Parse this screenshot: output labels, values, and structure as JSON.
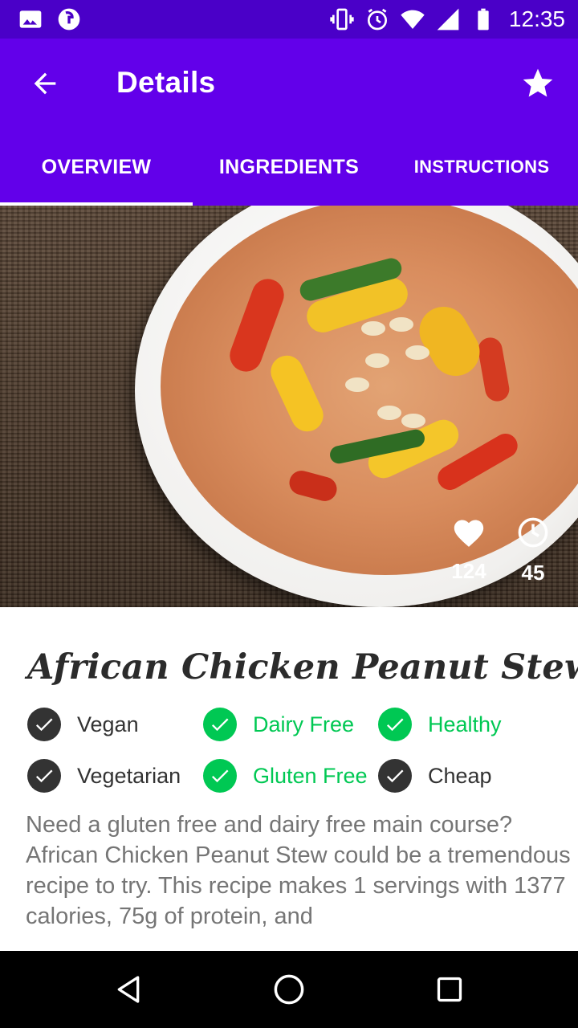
{
  "status_bar": {
    "time": "12:35",
    "left_icons": [
      "image-icon",
      "sync-icon"
    ],
    "right_icons": [
      "vibrate-icon",
      "alarm-icon",
      "wifi-icon",
      "signal-icon",
      "battery-icon"
    ]
  },
  "app_bar": {
    "title": "Details",
    "back_icon": "arrow-back-icon",
    "favorite_icon": "star-icon"
  },
  "tabs": [
    {
      "label": "OVERVIEW",
      "selected": true
    },
    {
      "label": "INGREDIENTS",
      "selected": false
    },
    {
      "label": "INSTRUCTIONS",
      "selected": false
    }
  ],
  "hero": {
    "likes": "124",
    "minutes": "45",
    "likes_icon": "heart-icon",
    "time_icon": "clock-icon"
  },
  "recipe": {
    "title": "African Chicken Peanut Stew",
    "summary": "Need a gluten free and dairy free main course? African Chicken Peanut Stew could be a tremendous recipe to try. This recipe makes 1 servings with 1377 calories, 75g of protein, and"
  },
  "badges": [
    {
      "label": "Vegan",
      "active": false
    },
    {
      "label": "Dairy Free",
      "active": true
    },
    {
      "label": "Healthy",
      "active": true
    },
    {
      "label": "Vegetarian",
      "active": false
    },
    {
      "label": "Gluten Free",
      "active": true
    },
    {
      "label": "Cheap",
      "active": false
    }
  ],
  "colors": {
    "status_bar": "#4a00c8",
    "primary": "#6200ea",
    "active_green": "#00c853",
    "inactive_dark": "#333333",
    "summary_text": "#757575"
  },
  "nav_bar": {
    "back_icon": "nav-back-icon",
    "home_icon": "nav-home-icon",
    "recents_icon": "nav-recents-icon"
  }
}
